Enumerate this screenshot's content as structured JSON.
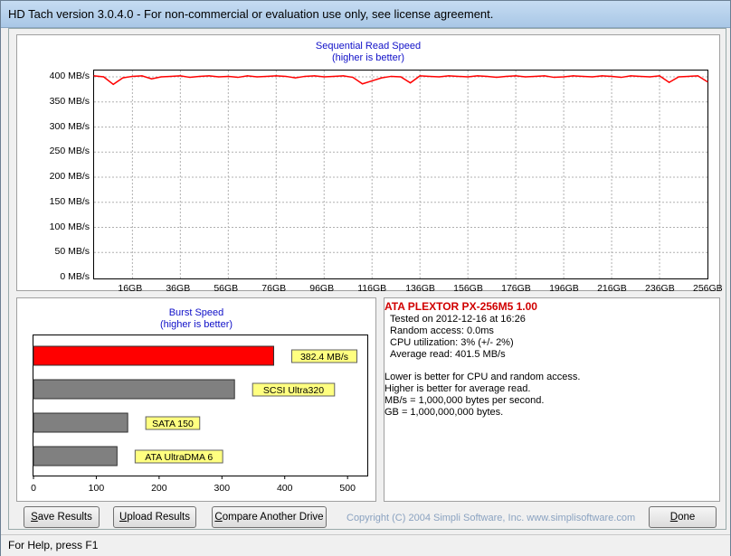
{
  "window": {
    "title": "HD Tach version 3.0.4.0  - For non-commercial or evaluation use only, see license agreement.",
    "status": "For Help, press F1"
  },
  "sequential_chart": {
    "title": "Sequential Read Speed",
    "subtitle": "(higher is better)",
    "y_ticks": [
      "0 MB/s",
      "50 MB/s",
      "100 MB/s",
      "150 MB/s",
      "200 MB/s",
      "250 MB/s",
      "300 MB/s",
      "350 MB/s",
      "400 MB/s"
    ],
    "x_ticks": [
      "16GB",
      "36GB",
      "56GB",
      "76GB",
      "96GB",
      "116GB",
      "136GB",
      "156GB",
      "176GB",
      "196GB",
      "216GB",
      "236GB",
      "256GB"
    ],
    "line_color": "#ff0000"
  },
  "burst_chart": {
    "title": "Burst Speed",
    "subtitle": "(higher is better)",
    "x_ticks": [
      "0",
      "100",
      "200",
      "300",
      "400",
      "500"
    ]
  },
  "chart_data": [
    {
      "type": "line",
      "title": "Sequential Read Speed",
      "subtitle": "(higher is better)",
      "xlabel": "",
      "ylabel": "",
      "xlim": [
        0,
        256
      ],
      "ylim": [
        0,
        400
      ],
      "x": [
        0,
        4,
        8,
        12,
        16,
        20,
        24,
        28,
        32,
        36,
        40,
        44,
        48,
        52,
        56,
        60,
        64,
        68,
        72,
        76,
        80,
        84,
        88,
        92,
        96,
        100,
        104,
        108,
        112,
        116,
        120,
        124,
        128,
        132,
        136,
        140,
        144,
        148,
        152,
        156,
        160,
        164,
        168,
        172,
        176,
        180,
        184,
        188,
        192,
        196,
        200,
        204,
        208,
        212,
        216,
        220,
        224,
        228,
        232,
        236,
        240,
        244,
        248,
        252,
        256
      ],
      "series": [
        {
          "values": [
            402,
            400,
            385,
            398,
            401,
            402,
            396,
            400,
            401,
            402,
            399,
            401,
            402,
            400,
            401,
            399,
            402,
            400,
            401,
            402,
            401,
            398,
            401,
            402,
            400,
            401,
            402,
            399,
            386,
            392,
            398,
            401,
            400,
            388,
            402,
            401,
            400,
            402,
            401,
            400,
            402,
            401,
            399,
            401,
            402,
            400,
            401,
            402,
            399,
            400,
            402,
            401,
            400,
            402,
            401,
            399,
            402,
            401,
            400,
            402,
            389,
            400,
            401,
            402,
            390
          ]
        }
      ]
    },
    {
      "type": "bar",
      "title": "Burst Speed",
      "subtitle": "(higher is better)",
      "orientation": "horizontal",
      "categories": [
        "382.4 MB/s",
        "SCSI Ultra320",
        "SATA 150",
        "ATA UltraDMA 6"
      ],
      "values": [
        382.4,
        320,
        150,
        133
      ],
      "colors": [
        "#ff0000",
        "#808080",
        "#808080",
        "#808080"
      ],
      "xlim": [
        0,
        530
      ],
      "xticks": [
        0,
        100,
        200,
        300,
        400,
        500
      ]
    }
  ],
  "info": {
    "drive": "ATA PLEXTOR PX-256M5 1.00",
    "tested": "Tested on 2012-12-16 at 16:26",
    "random_access": "Random access: 0.0ms",
    "cpu": "CPU utilization: 3% (+/- 2%)",
    "average_read": "Average read: 401.5 MB/s",
    "note1": "Lower is better for CPU and random access.",
    "note2": "Higher is better for average read.",
    "note3": "MB/s = 1,000,000 bytes per second.",
    "note4": "GB = 1,000,000,000 bytes."
  },
  "buttons": {
    "save_prefix": "S",
    "save_rest": "ave Results",
    "upload_prefix": "U",
    "upload_rest": "pload Results",
    "compare_prefix": "C",
    "compare_rest": "ompare Another Drive",
    "done_prefix": "D",
    "done_rest": "one"
  },
  "copyright": "Copyright (C) 2004 Simpli Software, Inc. www.simplisoftware.com"
}
